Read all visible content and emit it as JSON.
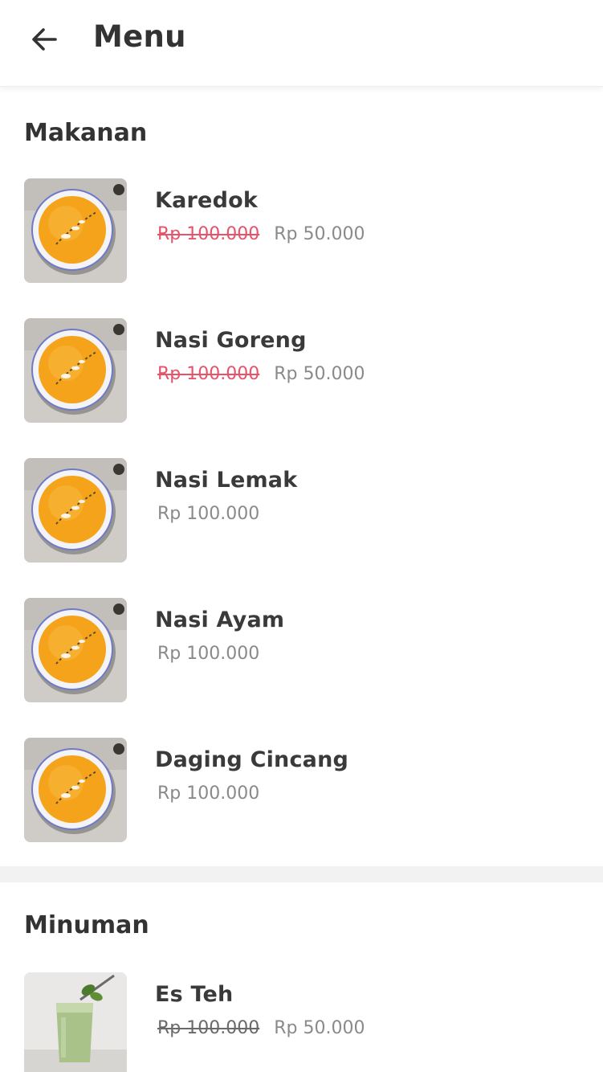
{
  "header": {
    "title": "Menu",
    "back_icon": "arrow-left-icon"
  },
  "colors": {
    "strike_red": "#e5546a",
    "strike_gray": "#6a6a6a",
    "price_gray": "#8a8a8a",
    "soup_orange": "#f5a31a",
    "section_divider": "#f2f2f2"
  },
  "sections": [
    {
      "title": "Makanan",
      "items": [
        {
          "name": "Karedok",
          "price_original": "Rp 100.000",
          "price_discount": "Rp 50.000",
          "image": "pumpkin-soup-bowl"
        },
        {
          "name": "Nasi Goreng",
          "price_original": "Rp 100.000",
          "price_discount": "Rp 50.000",
          "image": "pumpkin-soup-bowl"
        },
        {
          "name": "Nasi Lemak",
          "price": "Rp 100.000",
          "image": "pumpkin-soup-bowl"
        },
        {
          "name": "Nasi Ayam",
          "price": "Rp 100.000",
          "image": "pumpkin-soup-bowl"
        },
        {
          "name": "Daging Cincang",
          "price": "Rp 100.000",
          "image": "pumpkin-soup-bowl"
        }
      ]
    },
    {
      "title": "Minuman",
      "items": [
        {
          "name": "Es Teh",
          "price_original": "Rp 100.000",
          "price_discount": "Rp 50.000",
          "image": "green-smoothie-glass"
        }
      ]
    }
  ]
}
